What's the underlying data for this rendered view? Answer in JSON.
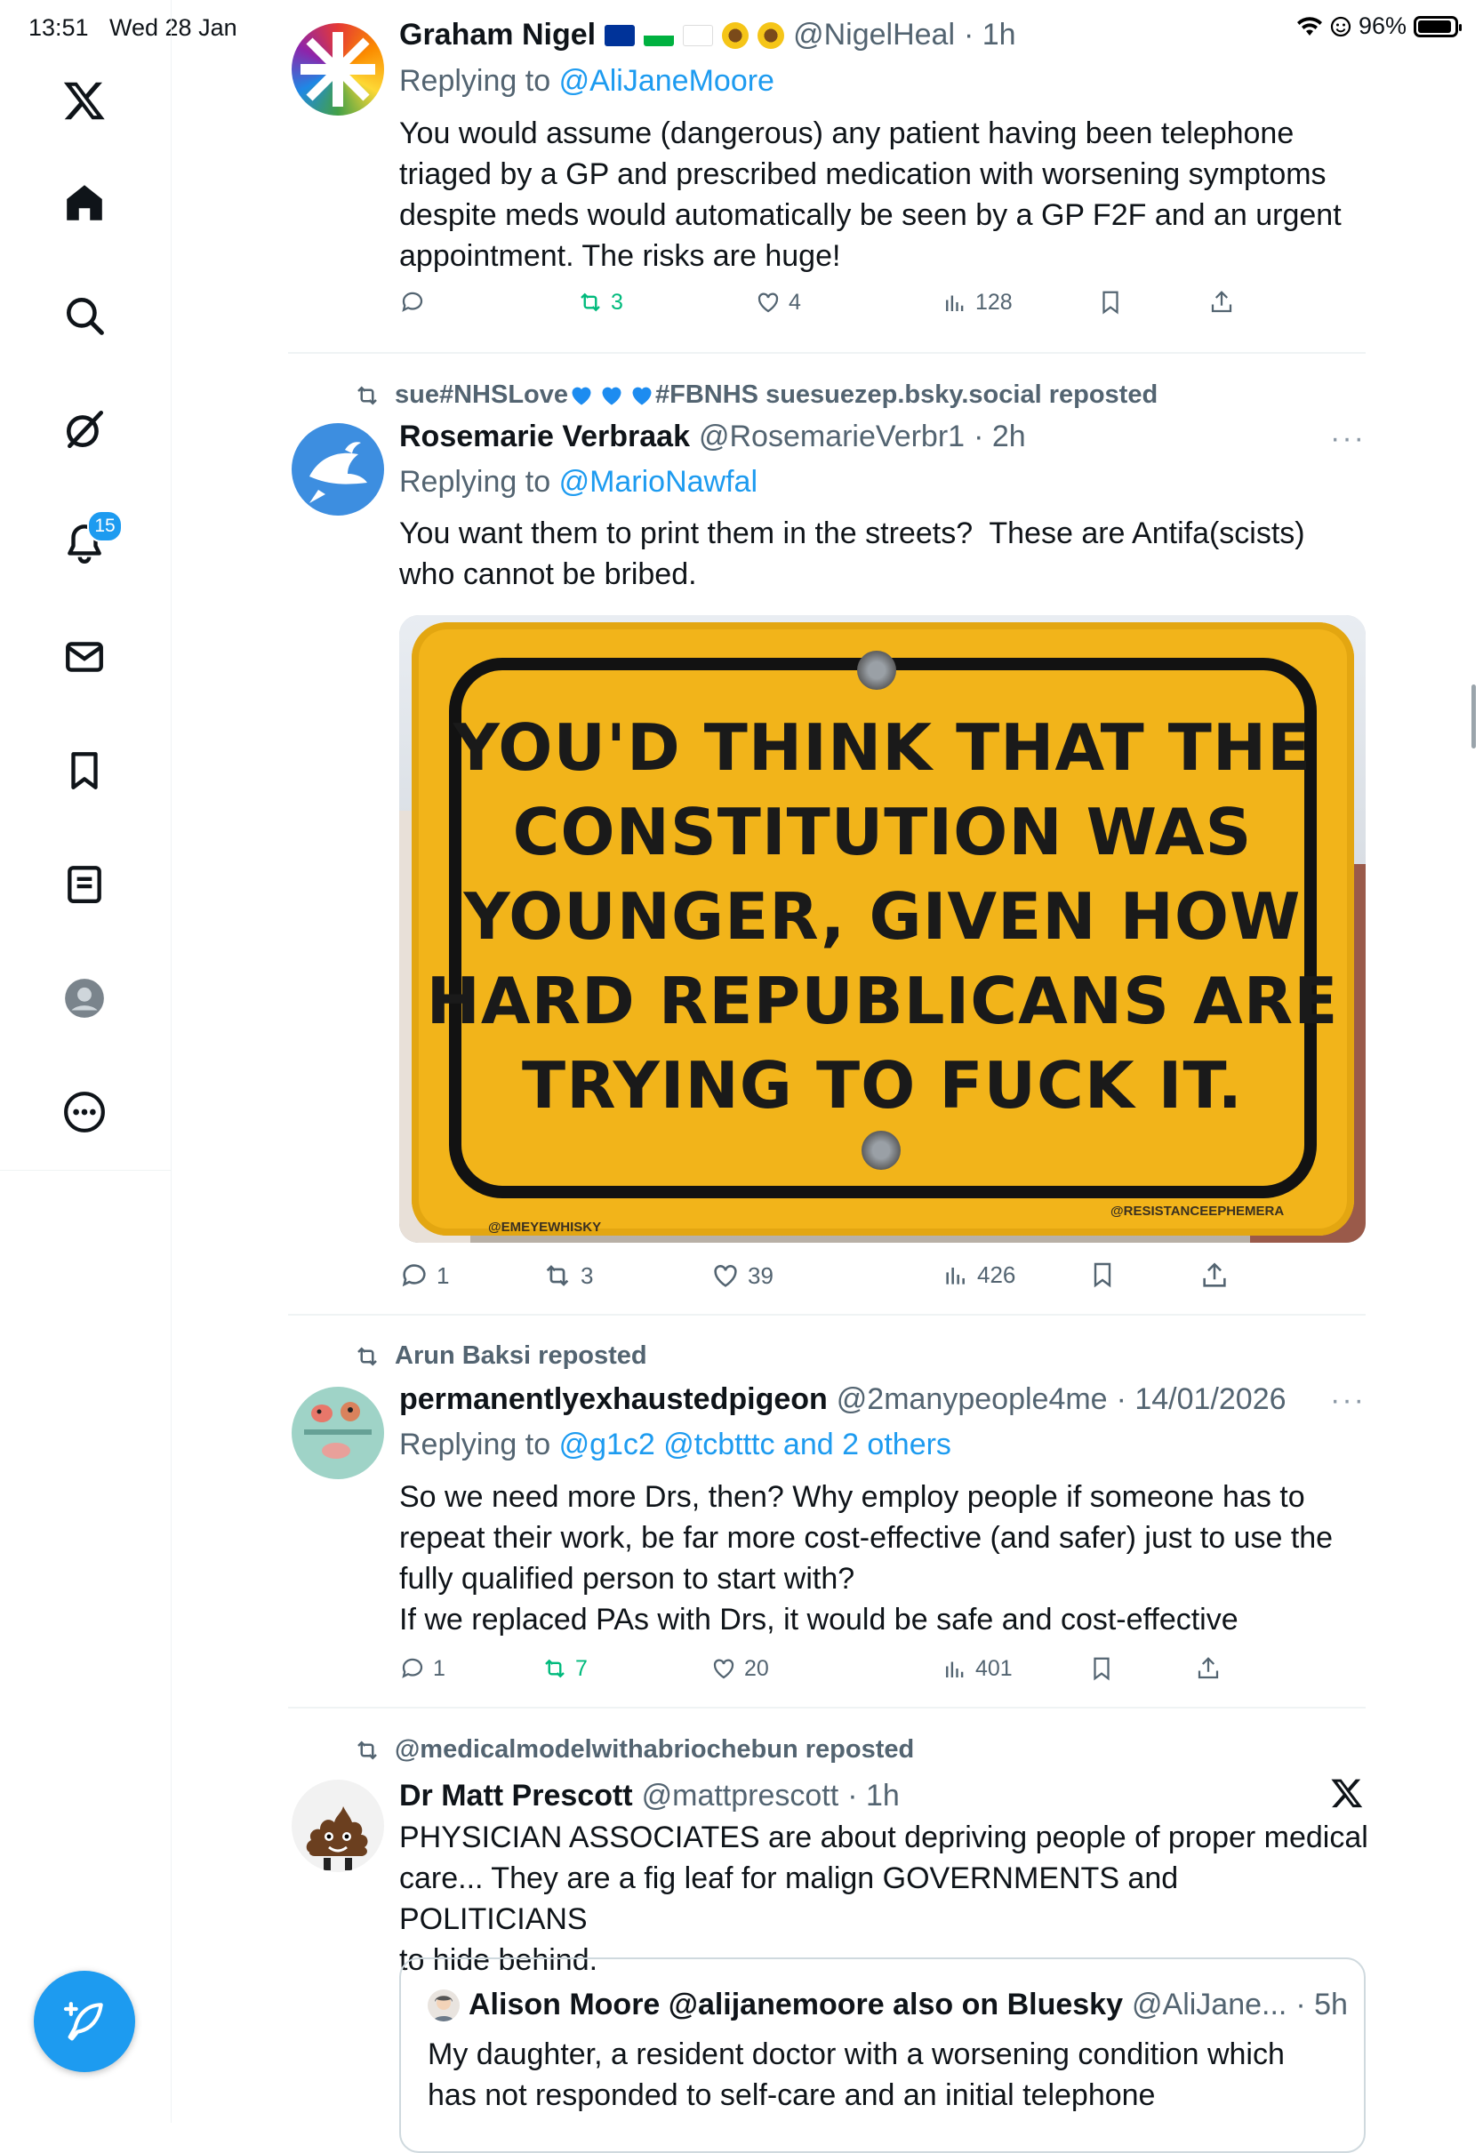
{
  "status_bar": {
    "time": "13:51",
    "date": "Wed 28 Jan",
    "battery": "96%"
  },
  "sidebar": {
    "notifications_badge": "15",
    "items": [
      "home",
      "search",
      "grok",
      "notifications",
      "messages",
      "bookmarks",
      "lists",
      "profile",
      "more"
    ]
  },
  "tweets": [
    {
      "name": "Graham Nigel",
      "handle": "@NigelHeal",
      "time": "· 1h",
      "replying_prefix": "Replying to",
      "replying_to": "@AliJaneMoore",
      "body": "You would assume (dangerous) any patient having been telephone\ntriaged by a GP and prescribed medication with worsening symptoms\ndespite meds would automatically be seen by a GP F2F and an urgent\nappointment. The risks are huge!",
      "retweets": "3",
      "likes": "4",
      "views": "128"
    },
    {
      "repost_by_prefix": "sue#NHSLove",
      "repost_by_suffix": "#FBNHS suesuezep.bsky.social reposted",
      "name": "Rosemarie Verbraak",
      "handle": "@RosemarieVerbr1",
      "time": "· 2h",
      "more": "···",
      "replying_prefix": "Replying to",
      "replying_to": "@MarioNawfal",
      "body": "You want them to print them in the streets?  These are Antifa(scists)\nwho cannot be bribed.",
      "image_text": "YOU'D THINK THAT THE\nCONSTITUTION WAS\nYOUNGER, GIVEN HOW\nHARD REPUBLICANS ARE\nTRYING TO FUCK IT.",
      "image_credit_left": "@EMEYEWHISKY",
      "image_credit_right": "@RESISTANCEEPHEMERA",
      "replies": "1",
      "retweets": "3",
      "likes": "39",
      "views": "426"
    },
    {
      "repost_by": "Arun Baksi reposted",
      "name": "permanentlyexhaustedpigeon",
      "handle": "@2manypeople4me",
      "time": "· 14/01/2026",
      "more": "···",
      "replying_prefix": "Replying to",
      "replying_to": "@g1c2 @tcbtttc and 2 others",
      "body": "So we need more Drs, then? Why employ people if someone has to\nrepeat their work, be far more cost-effective (and safer) just to use the\nfully qualified person to start with?\nIf we replaced PAs with Drs, it would be safe and cost-effective",
      "replies": "1",
      "retweets": "7",
      "likes": "20",
      "views": "401"
    },
    {
      "repost_by": "@medicalmodelwithabriochebun reposted",
      "name": "Dr Matt Prescott",
      "handle": "@mattprescott",
      "time": "· 1h",
      "body": "PHYSICIAN ASSOCIATES are about depriving people of proper medical\ncare... They are a fig leaf for malign GOVERNMENTS and POLITICIANS\nto hide behind.",
      "quote": {
        "name": "Alison Moore @alijanemoore also on Bluesky",
        "handle": "@AliJane...",
        "time": "· 5h",
        "body": "My daughter, a resident doctor with a worsening condition which\nhas not responded to self-care and an initial telephone"
      }
    }
  ],
  "colors": {
    "accent": "#1d9bf0",
    "retweet_green": "#00ba7c",
    "secondary_text": "#536471",
    "sign_yellow": "#f2b41a"
  }
}
